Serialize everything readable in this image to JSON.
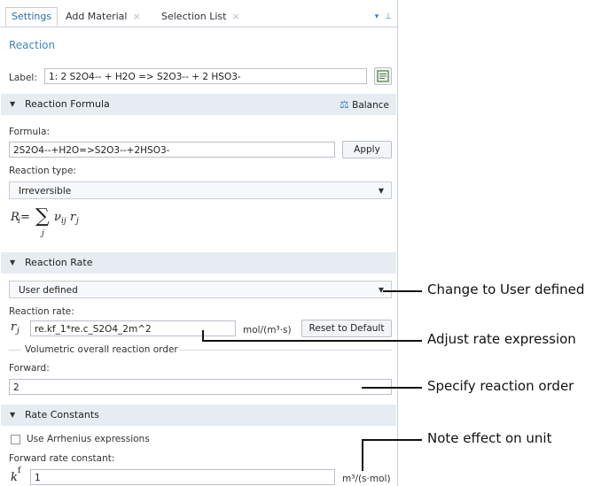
{
  "tabs": [
    {
      "label": "Settings"
    },
    {
      "label": "Add Material",
      "closable": "×"
    },
    {
      "label": "Selection List",
      "closable": "×"
    }
  ],
  "tab_tools": {
    "menu_icon": "chevron-down-icon",
    "pin_icon": "pin-icon",
    "menu_glyph": "▾",
    "pin_glyph": "⊥"
  },
  "node_title": "Reaction",
  "label_row": {
    "label": "Label:",
    "value": "1: 2 S2O4-- + H2O => S2O3-- + 2 HSO3-"
  },
  "sections": {
    "formula": "Reaction Formula",
    "rate": "Reaction Rate",
    "constants": "Rate Constants"
  },
  "balance_button": "Balance",
  "formula": {
    "label": "Formula:",
    "value": "2S2O4--+H2O=>S2O3--+2HSO3-",
    "apply": "Apply"
  },
  "reaction_type": {
    "label": "Reaction type:",
    "selected": "Irreversible"
  },
  "rate_eq": {
    "lhs": "R",
    "sub_i": "i",
    "equals": " = ",
    "sigma": "∑",
    "sum_index": "j",
    "nu": "ν",
    "nu_sub": "ij",
    "r": "r",
    "r_sub": "j"
  },
  "rate_mode": {
    "selected": "User defined"
  },
  "reaction_rate": {
    "label": "Reaction rate:",
    "symbol": "r",
    "symbol_sub": "j",
    "value": "re.kf_1*re.c_S2O4_2m^2",
    "unit": "mol/(m³·s)",
    "reset": "Reset to Default"
  },
  "order_group": {
    "title": "Volumetric overall reaction order",
    "forward_label": "Forward:",
    "forward_value": "2"
  },
  "constants": {
    "arrhenius": "Use Arrhenius expressions",
    "arrhenius_checked": false,
    "forward_label": "Forward rate constant:",
    "symbol": "k",
    "symbol_sup": "f",
    "value": "1",
    "unit": "m³/(s·mol)"
  },
  "callouts": [
    {
      "text": "Change to User defined"
    },
    {
      "text": "Adjust rate expression"
    },
    {
      "text": "Specify reaction order"
    },
    {
      "text": "Note effect on unit"
    }
  ],
  "colors": {
    "accent": "#3d85c6",
    "section_bg": "#e6ecf2",
    "border": "#c9cfd6"
  }
}
